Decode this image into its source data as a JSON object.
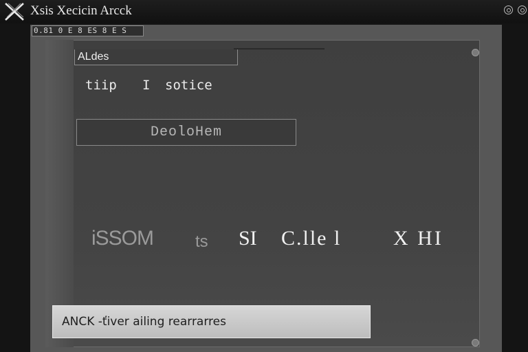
{
  "window": {
    "title": "Xsis Xecicin Arcck",
    "logo_icon": "x-logo-icon"
  },
  "tabstrip": {
    "text": "0.81 0 E 8 ES 8 E S"
  },
  "panel": {
    "field_label": "ALdes",
    "caption_left": "tiip",
    "caption_mid": "I",
    "caption_right": "sotice",
    "field_value": "DeoloHem",
    "row": [
      {
        "text": "iSSOM",
        "color": "#9a9a9a"
      },
      {
        "text": "ts",
        "color": "#9a9a9a"
      },
      {
        "text": "SI",
        "color": "#f2f2f2"
      },
      {
        "text": "C.lle l",
        "color": "#f2f2f2"
      },
      {
        "text": "X HI",
        "color": "#f2f2f2"
      }
    ]
  },
  "statusbar": {
    "text": "ANCK -ťiver ailing rearrarres"
  },
  "colors": {
    "background": "#141414",
    "panel": "#434343",
    "statusbar": "#cfcfcf"
  }
}
